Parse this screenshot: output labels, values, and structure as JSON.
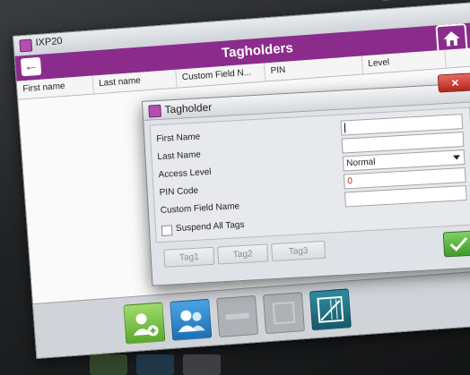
{
  "window": {
    "title": "IXP20",
    "minimize_symbol": "▭",
    "maximize_symbol": "▢",
    "close_symbol": "✕"
  },
  "header": {
    "title": "Tagholders",
    "back_symbol": "←"
  },
  "table": {
    "columns": [
      "First name",
      "Last name",
      "Custom Field N...",
      "PIN",
      "Level"
    ]
  },
  "dialog": {
    "title": "Tagholder",
    "close_symbol": "✕",
    "fields": {
      "first_name_label": "First Name",
      "first_name_value": "",
      "last_name_label": "Last Name",
      "last_name_value": "",
      "access_level_label": "Access Level",
      "access_level_value": "Normal",
      "pin_label": "PIN Code",
      "pin_value": "0",
      "custom_field_label": "Custom Field Name",
      "custom_field_value": ""
    },
    "suspend_label": "Suspend All Tags",
    "suspend_checked": false,
    "tags": [
      "Tag1",
      "Tag2",
      "Tag3"
    ]
  },
  "colors": {
    "brand": "#8b2c8c",
    "ok": "#4caf3a",
    "pin_text": "#c2231a"
  },
  "toolbar": {
    "buttons": [
      "add-tagholder-icon",
      "tagholders-icon",
      "remove-disabled-icon",
      "disabled-icon",
      "report-icon"
    ]
  }
}
